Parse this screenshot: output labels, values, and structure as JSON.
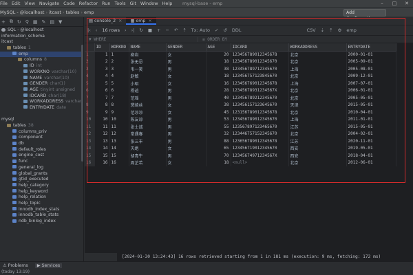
{
  "menu": {
    "items": [
      "File",
      "Edit",
      "View",
      "Navigate",
      "Code",
      "Refactor",
      "Run",
      "Tools",
      "Git",
      "Window",
      "Help"
    ],
    "title": "mysql-base - emp"
  },
  "breadcrumbs": [
    "MySQL - @localhost",
    "itcast",
    "tables",
    "emp"
  ],
  "add_config": "Add Configuration...",
  "sidebar": {
    "tree": [
      {
        "text": "SQL - @localhost",
        "hint": "",
        "icon": "db",
        "indent": 0,
        "selected": false
      },
      {
        "text": "information_schema",
        "hint": "",
        "icon": "",
        "indent": 0,
        "selected": false
      },
      {
        "text": "itcast",
        "hint": "",
        "icon": "",
        "indent": 0,
        "selected": false
      },
      {
        "text": "tables",
        "hint": "1",
        "icon": "folder",
        "indent": 1,
        "selected": false
      },
      {
        "text": "emp",
        "hint": "",
        "icon": "tbl",
        "indent": 2,
        "selected": true
      },
      {
        "text": "columns",
        "hint": "8",
        "icon": "folder",
        "indent": 3,
        "selected": false
      },
      {
        "text": "ID",
        "hint": "int",
        "icon": "col",
        "indent": 4,
        "selected": false
      },
      {
        "text": "WORKNO",
        "hint": "varchar(10)",
        "icon": "col",
        "indent": 4,
        "selected": false
      },
      {
        "text": "NAME",
        "hint": "varchar(10)",
        "icon": "col",
        "indent": 4,
        "selected": false
      },
      {
        "text": "GENDER",
        "hint": "char(1)",
        "icon": "col",
        "indent": 4,
        "selected": false
      },
      {
        "text": "AGE",
        "hint": "tinyint unsigned",
        "icon": "col",
        "indent": 4,
        "selected": false
      },
      {
        "text": "IDCARD",
        "hint": "char(18)",
        "icon": "col",
        "indent": 4,
        "selected": false
      },
      {
        "text": "WORKADDRESS",
        "hint": "varchar(50)",
        "icon": "col",
        "indent": 4,
        "selected": false
      },
      {
        "text": "ENTRYDATE",
        "hint": "date",
        "icon": "col",
        "indent": 4,
        "selected": false
      },
      {
        "text": "",
        "hint": "",
        "icon": "",
        "indent": 0,
        "selected": false
      },
      {
        "text": "mysql",
        "hint": "",
        "icon": "",
        "indent": 0,
        "selected": false
      },
      {
        "text": "tables",
        "hint": "38",
        "icon": "folder",
        "indent": 1,
        "selected": false
      },
      {
        "text": "columns_priv",
        "hint": "",
        "icon": "tbl",
        "indent": 2,
        "selected": false
      },
      {
        "text": "component",
        "hint": "",
        "icon": "tbl",
        "indent": 2,
        "selected": false
      },
      {
        "text": "db",
        "hint": "",
        "icon": "tbl",
        "indent": 2,
        "selected": false
      },
      {
        "text": "default_roles",
        "hint": "",
        "icon": "tbl",
        "indent": 2,
        "selected": false
      },
      {
        "text": "engine_cost",
        "hint": "",
        "icon": "tbl",
        "indent": 2,
        "selected": false
      },
      {
        "text": "func",
        "hint": "",
        "icon": "tbl",
        "indent": 2,
        "selected": false
      },
      {
        "text": "general_log",
        "hint": "",
        "icon": "tbl",
        "indent": 2,
        "selected": false
      },
      {
        "text": "global_grants",
        "hint": "",
        "icon": "tbl",
        "indent": 2,
        "selected": false
      },
      {
        "text": "gtid_executed",
        "hint": "",
        "icon": "tbl",
        "indent": 2,
        "selected": false
      },
      {
        "text": "help_category",
        "hint": "",
        "icon": "tbl",
        "indent": 2,
        "selected": false
      },
      {
        "text": "help_keyword",
        "hint": "",
        "icon": "tbl",
        "indent": 2,
        "selected": false
      },
      {
        "text": "help_relation",
        "hint": "",
        "icon": "tbl",
        "indent": 2,
        "selected": false
      },
      {
        "text": "help_topic",
        "hint": "",
        "icon": "tbl",
        "indent": 2,
        "selected": false
      },
      {
        "text": "innodb_index_stats",
        "hint": "",
        "icon": "tbl",
        "indent": 2,
        "selected": false
      },
      {
        "text": "innodb_table_stats",
        "hint": "",
        "icon": "tbl",
        "indent": 2,
        "selected": false
      },
      {
        "text": "ndb_binlog_index",
        "hint": "",
        "icon": "tbl",
        "indent": 2,
        "selected": false
      }
    ]
  },
  "tabs": [
    {
      "label": "console_2",
      "active": false
    },
    {
      "label": "emp",
      "active": true
    }
  ],
  "toolbar": {
    "rows_label": "16 rows",
    "tx_label": "Tx: Auto",
    "ddl_label": "DDL",
    "csv_label": "CSV",
    "schema_label": "emp"
  },
  "filters": {
    "where_label": "WHERE",
    "orderby_label": "ORDER BY"
  },
  "grid": {
    "columns": [
      "ID",
      "WORKNO",
      "NAME",
      "GENDER",
      "AGE",
      "IDCARD",
      "WORKADDRESS",
      "ENTRYDATE"
    ],
    "rows": [
      [
        "1",
        "1",
        "1",
        "柳岩",
        "女",
        "20",
        "123456789012345678",
        "北京",
        "2000-01-01"
      ],
      [
        "2",
        "2",
        "2",
        "张无忌",
        "男",
        "18",
        "123456789012345670",
        "北京",
        "2005-09-01"
      ],
      [
        "3",
        "3",
        "3",
        "韦一笑",
        "男",
        "38",
        "123456789712345670",
        "上海",
        "2005-08-01"
      ],
      [
        "4",
        "4",
        "4",
        "赵敏",
        "女",
        "18",
        "123456757123845670",
        "北京",
        "2009-12-01"
      ],
      [
        "5",
        "5",
        "5",
        "小昭",
        "女",
        "16",
        "123456769012345678",
        "上海",
        "2007-07-01"
      ],
      [
        "6",
        "6",
        "6",
        "杨逍",
        "男",
        "28",
        "12345678931234567X",
        "北京",
        "2006-01-01"
      ],
      [
        "7",
        "7",
        "7",
        "范瑶",
        "男",
        "40",
        "123456789212345670",
        "北京",
        "2005-05-01"
      ],
      [
        "8",
        "8",
        "8",
        "黛绮丝",
        "女",
        "38",
        "123456157123645670",
        "天津",
        "2015-05-01"
      ],
      [
        "9",
        "9",
        "9",
        "范凉凉",
        "女",
        "45",
        "123156789012345678",
        "北京",
        "2010-04-01"
      ],
      [
        "10",
        "10",
        "10",
        "陈友谅",
        "男",
        "53",
        "123456789012345670",
        "上海",
        "2011-01-01"
      ],
      [
        "11",
        "11",
        "11",
        "张士诚",
        "男",
        "55",
        "123567897123465670",
        "江苏",
        "2015-05-01"
      ],
      [
        "12",
        "12",
        "12",
        "常遇春",
        "男",
        "32",
        "123446757152345670",
        "北京",
        "2004-02-01"
      ],
      [
        "13",
        "13",
        "13",
        "张三丰",
        "男",
        "88",
        "123656789012345678",
        "江苏",
        "2020-11-01"
      ],
      [
        "14",
        "14",
        "14",
        "灭绝",
        "女",
        "65",
        "123456719012345670",
        "西安",
        "2019-05-01"
      ],
      [
        "15",
        "15",
        "15",
        "胡青牛",
        "男",
        "70",
        "12345674971234567X",
        "西安",
        "2018-04-01"
      ],
      [
        "16",
        "16",
        "16",
        "周芷若",
        "女",
        "18",
        "<null>",
        "北京",
        "2012-06-01"
      ]
    ]
  },
  "console_text": "[2024-01-30 13:24:43] 16 rows retrieved starting from 1 in 181 ms (execution: 9 ms, fetching: 172 ms)",
  "bottom_tabs": [
    "Problems",
    "Services"
  ],
  "status_text": "(today 13:19)"
}
